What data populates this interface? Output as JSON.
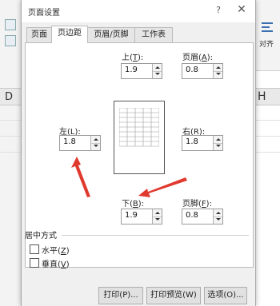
{
  "background": {
    "left_col_letter": "D",
    "right_col_letter": "H",
    "ribbon_label": "对齐"
  },
  "dialog": {
    "title": "页面设置",
    "help": "?",
    "close": "✕",
    "tabs": [
      "页面",
      "页边距",
      "页眉/页脚",
      "工作表"
    ],
    "active_tab": "页边距"
  },
  "margins": {
    "top": {
      "label": "上(",
      "key": "T",
      "suffix": "):",
      "value": "1.9"
    },
    "header": {
      "label": "页眉(",
      "key": "A",
      "suffix": "):",
      "value": "0.8"
    },
    "left": {
      "label": "左(",
      "key": "L",
      "suffix": "):",
      "value": "1.8"
    },
    "right": {
      "label": "右(",
      "key": "R",
      "suffix": "):",
      "value": "1.8"
    },
    "bottom": {
      "label": "下(",
      "key": "B",
      "suffix": "):",
      "value": "1.9"
    },
    "footer": {
      "label": "页脚(",
      "key": "F",
      "suffix": "):",
      "value": "0.8"
    }
  },
  "centering": {
    "title": "居中方式",
    "horizontal": {
      "label": "水平(",
      "key": "Z",
      "suffix": ")",
      "checked": false
    },
    "vertical": {
      "label": "垂直(",
      "key": "V",
      "suffix": ")",
      "checked": false
    }
  },
  "buttons": {
    "print": "打印(P)...",
    "preview": "打印预览(W)",
    "options": "选项(O)..."
  },
  "colors": {
    "annotation_arrow": "#e03a2f",
    "dialog_bg": "#f0f0f0"
  }
}
